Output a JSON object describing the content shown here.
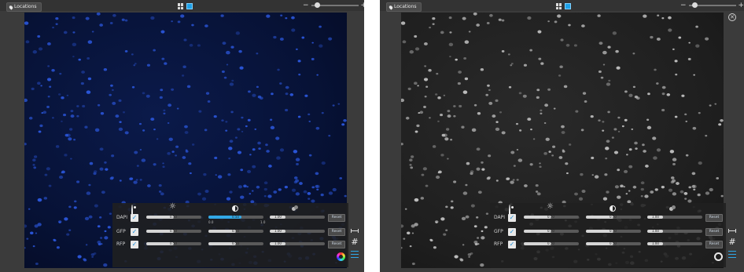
{
  "colors": {
    "accent": "#1ea1e8",
    "left_nucleus": "#2a55d8",
    "right_nucleus": "#bdbdbd"
  },
  "panels": [
    {
      "id": "left",
      "locations_label": "Locations",
      "zoom_minus": "−",
      "zoom_plus": "+",
      "channels": [
        {
          "name": "DAPI",
          "checked": true,
          "brightness": "0.50",
          "contrast": "0.50",
          "gamma": "1.00"
        },
        {
          "name": "GFP",
          "checked": true,
          "brightness": "0.50",
          "contrast": "0.50",
          "gamma": "1.00"
        },
        {
          "name": "RFP",
          "checked": true,
          "brightness": "0.50",
          "contrast": "0.50",
          "gamma": "1.00"
        }
      ],
      "scale_min": "0.0",
      "scale_max": "1.0",
      "reset_label": "Reset"
    },
    {
      "id": "right",
      "locations_label": "Locations",
      "zoom_minus": "−",
      "zoom_plus": "+",
      "channels": [
        {
          "name": "DAPI",
          "checked": true,
          "brightness": "0.50",
          "contrast": "0.50",
          "gamma": "1.00"
        },
        {
          "name": "GFP",
          "checked": true,
          "brightness": "0.50",
          "contrast": "0.50",
          "gamma": "1.00"
        },
        {
          "name": "RFP",
          "checked": true,
          "brightness": "0.50",
          "contrast": "0.50",
          "gamma": "1.00"
        }
      ],
      "reset_label": "Reset"
    }
  ],
  "icons": [
    "location-pin-icon",
    "grid-view-icon",
    "single-view-icon",
    "close-icon",
    "eye-icon",
    "brightness-icon",
    "contrast-icon",
    "gamma-icon",
    "measure-icon",
    "grid-overlay-icon",
    "adjust-icon",
    "color-wheel-icon",
    "grayscale-icon"
  ]
}
